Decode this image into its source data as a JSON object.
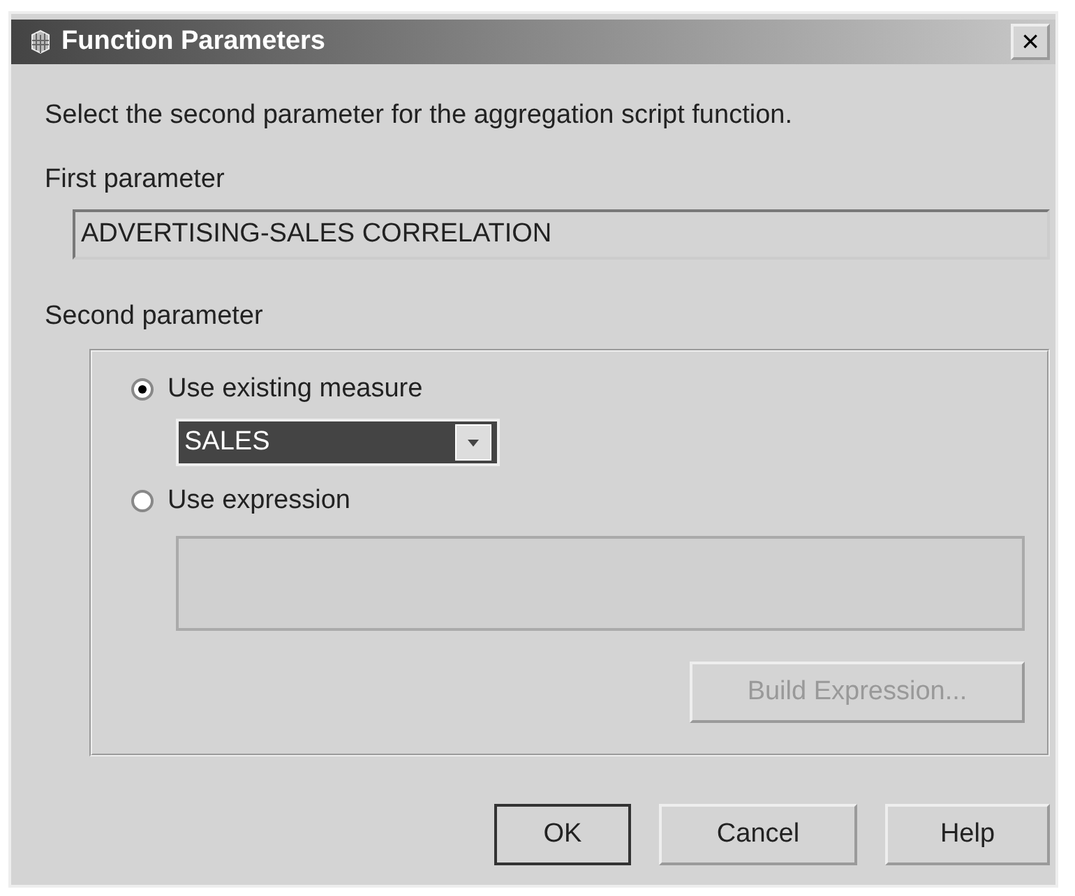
{
  "window": {
    "title": "Function Parameters",
    "close": "×"
  },
  "instruction": "Select the second parameter for the aggregation script function.",
  "first_parameter": {
    "label": "First parameter",
    "value": "ADVERTISING-SALES CORRELATION"
  },
  "second_parameter": {
    "label": "Second parameter",
    "options": [
      {
        "label": "Use existing measure",
        "selected": true
      },
      {
        "label": "Use expression",
        "selected": false
      }
    ],
    "measure": {
      "value": "SALES"
    },
    "build_button": {
      "label": "Build Expression...",
      "disabled": true
    }
  },
  "buttons": [
    {
      "label": "OK",
      "default": true
    },
    {
      "label": "Cancel",
      "default": false
    },
    {
      "label": "Help",
      "default": false
    }
  ]
}
